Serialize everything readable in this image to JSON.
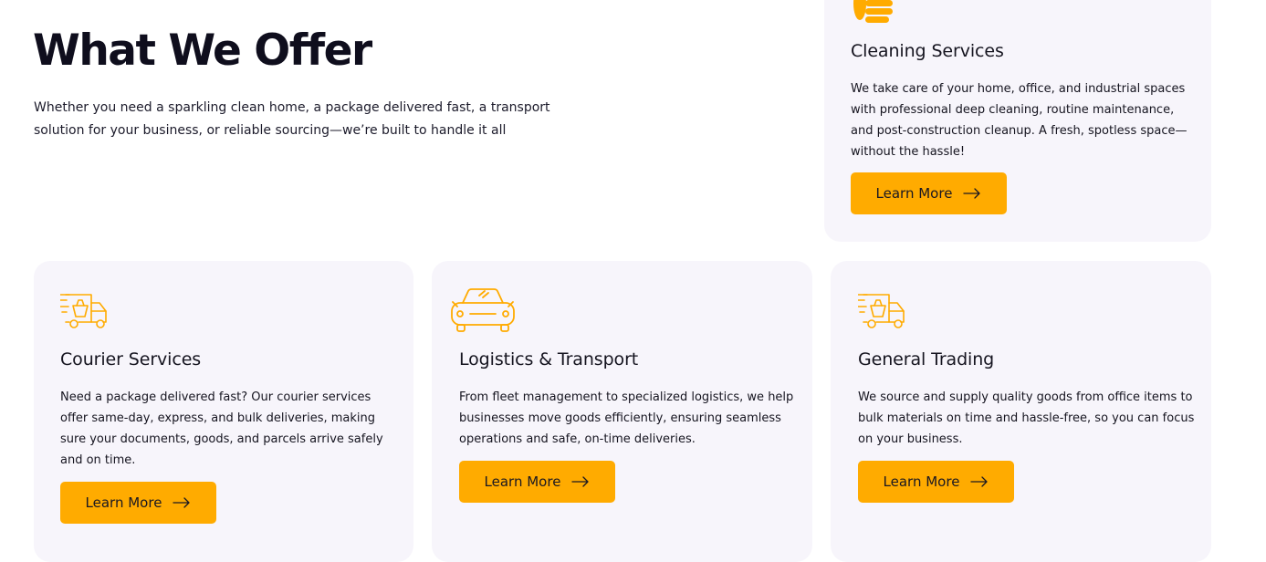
{
  "section": {
    "heading": "What We Offer",
    "intro": "Whether you need a sparkling clean home, a package delivered fast, a transport solution for your business, or reliable sourcing—we’re built to handle it all"
  },
  "colors": {
    "accent": "#ffab00",
    "card_bg": "#f7f5fb",
    "text": "#14121f"
  },
  "services": [
    {
      "icon": "cleaning-hand-icon",
      "title": "Cleaning Services",
      "description": "We take care of your home, office, and industrial spaces with professional deep cleaning, routine maintenance, and post-construction cleanup. A fresh, spotless space—without the hassle!",
      "button_label": "Learn More",
      "button_icon": "arrow-right-icon"
    },
    {
      "icon": "delivery-van-icon",
      "title": "Courier Services",
      "description": "Need a package delivered fast? Our courier services offer same-day, express, and bulk deliveries, making sure your documents, goods, and parcels arrive safely and on time.",
      "button_label": "Learn More",
      "button_icon": "arrow-right-icon"
    },
    {
      "icon": "car-icon",
      "title": "Logistics & Transport",
      "description": "From fleet management to specialized logistics, we help businesses move goods efficiently, ensuring seamless operations and safe, on-time deliveries.",
      "button_label": "Learn More",
      "button_icon": "arrow-right-icon"
    },
    {
      "icon": "delivery-van-icon",
      "title": "General Trading",
      "description": "We source and supply quality goods from office items to bulk materials on time and hassle-free, so you can focus on your business.",
      "button_label": "Learn More",
      "button_icon": "arrow-right-icon"
    }
  ]
}
